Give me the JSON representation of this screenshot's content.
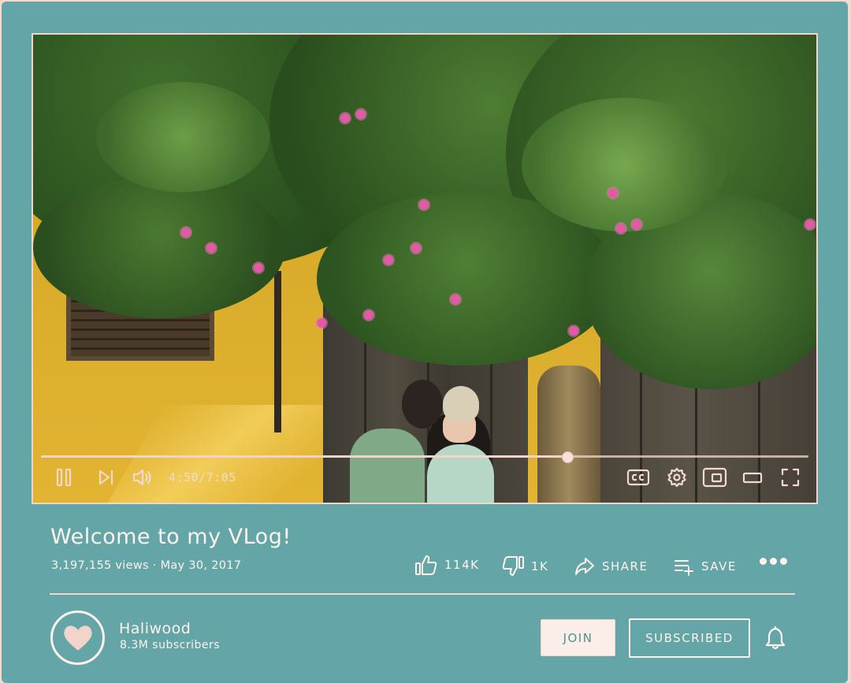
{
  "video": {
    "time_display": "4:50/7:05",
    "progress": 0.685,
    "icons": [
      "pause-icon",
      "skip-next-icon",
      "volume-icon",
      "captions-icon",
      "settings-icon",
      "miniplayer-icon",
      "theater-mode-icon",
      "fullscreen-icon"
    ]
  },
  "info": {
    "title": "Welcome to my VLog!",
    "meta": "3,197,155 views · May 30, 2017",
    "like_count": "114K",
    "dislike_count": "1K",
    "share_label": "SHARE",
    "save_label": "SAVE"
  },
  "channel": {
    "name": "Haliwood",
    "subscribers": "8.3M subscribers",
    "join_label": "JOIN",
    "subscribed_label": "SUBSCRIBED"
  },
  "colors": {
    "background": "#64a6a7",
    "accent": "#f2d4cb",
    "text": "#fdf2ec",
    "join_text": "#4d9294"
  }
}
